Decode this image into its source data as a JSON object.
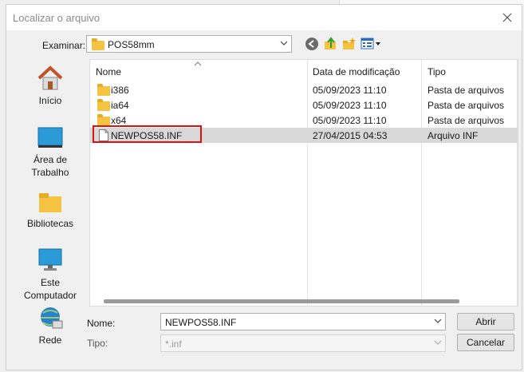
{
  "window": {
    "title": "Localizar o arquivo"
  },
  "toolbar": {
    "look_in_label": "Examinar:",
    "look_in_value": "POS58mm"
  },
  "places": [
    {
      "label": "Início"
    },
    {
      "label": "Área de Trabalho"
    },
    {
      "label": "Bibliotecas"
    },
    {
      "label": "Este Computador"
    },
    {
      "label": "Rede"
    }
  ],
  "columns": {
    "name": "Nome",
    "modified": "Data de modificação",
    "type": "Tipo"
  },
  "files": [
    {
      "name": "i386",
      "modified": "05/09/2023 11:10",
      "type": "Pasta de arquivos",
      "kind": "folder"
    },
    {
      "name": "ia64",
      "modified": "05/09/2023 11:10",
      "type": "Pasta de arquivos",
      "kind": "folder"
    },
    {
      "name": "x64",
      "modified": "05/09/2023 11:10",
      "type": "Pasta de arquivos",
      "kind": "folder"
    },
    {
      "name": "NEWPOS58.INF",
      "modified": "27/04/2015 04:53",
      "type": "Arquivo INF",
      "kind": "file",
      "selected": true
    }
  ],
  "filename": {
    "label": "Nome:",
    "value": "NEWPOS58.INF"
  },
  "filetype": {
    "label": "Tipo:",
    "value": "*.inf"
  },
  "buttons": {
    "open": "Abrir",
    "cancel": "Cancelar"
  },
  "colors": {
    "highlight_box": "#e01010",
    "selection": "#d9d9d9"
  }
}
